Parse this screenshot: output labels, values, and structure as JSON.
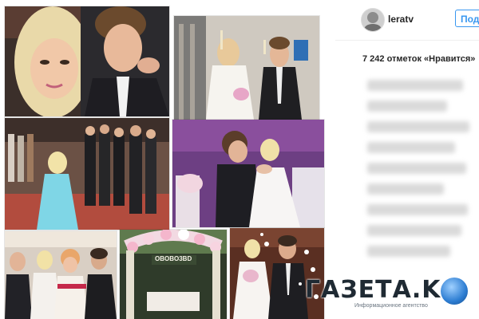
{
  "post": {
    "username": "leratv",
    "follow_label": "Под",
    "likes_text": "7 242 отметок «Нравится»"
  },
  "watermark": {
    "logo_text": "ГАЗЕТА.KG",
    "tagline": "Информационное агентство"
  },
  "collage": {
    "photos": [
      {
        "name": "selfie-photo",
        "icon": "photo-couple-selfie"
      },
      {
        "name": "champagne-toast-photo",
        "icon": "photo-champagne-toast"
      },
      {
        "name": "ballroom-guests-photo",
        "icon": "photo-ballroom-guests"
      },
      {
        "name": "first-dance-photo",
        "icon": "photo-first-dance"
      },
      {
        "name": "group-photo",
        "icon": "photo-group"
      },
      {
        "name": "flower-arch-photo",
        "icon": "photo-flower-arch"
      },
      {
        "name": "confetti-couple-photo",
        "icon": "photo-confetti-couple"
      }
    ],
    "arch_sign": "OBOBO3BD"
  },
  "colors": {
    "follow_blue": "#3897f0",
    "text_dark": "#262626"
  }
}
